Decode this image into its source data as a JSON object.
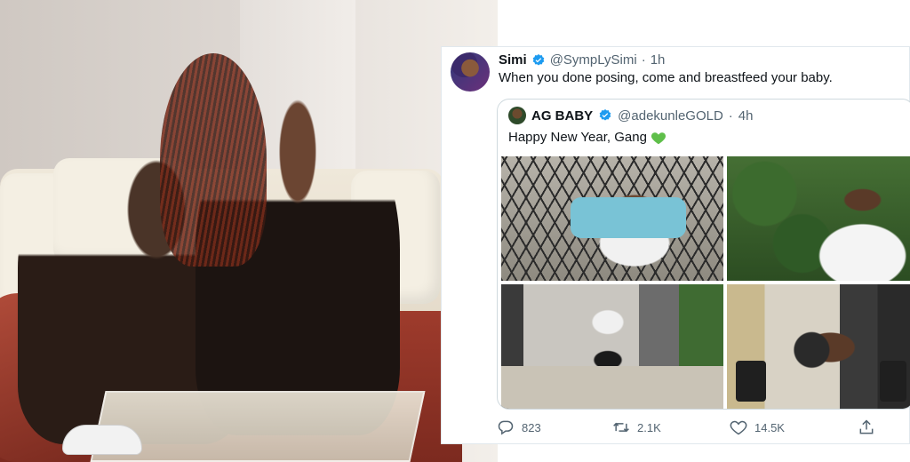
{
  "tweet": {
    "name": "Simi",
    "handle": "@SympLySimi",
    "separator": "·",
    "time": "1h",
    "text": "When you done posing, come and breastfeed your baby."
  },
  "quoted": {
    "name": "AG BABY",
    "handle": "@adekunleGOLD",
    "separator": "·",
    "time": "4h",
    "text": "Happy New Year, Gang"
  },
  "actions": {
    "replies": "823",
    "retweets": "2.1K",
    "likes": "14.5K"
  },
  "icons": {
    "verified": "verified-badge-icon",
    "reply": "reply-icon",
    "retweet": "retweet-icon",
    "like": "heart-icon",
    "share": "share-icon",
    "green_heart": "green-heart-icon"
  },
  "colors": {
    "verified": "#1d9bf0",
    "text": "#0f1419",
    "muted": "#536471",
    "green_heart": "#5fbf4a"
  }
}
